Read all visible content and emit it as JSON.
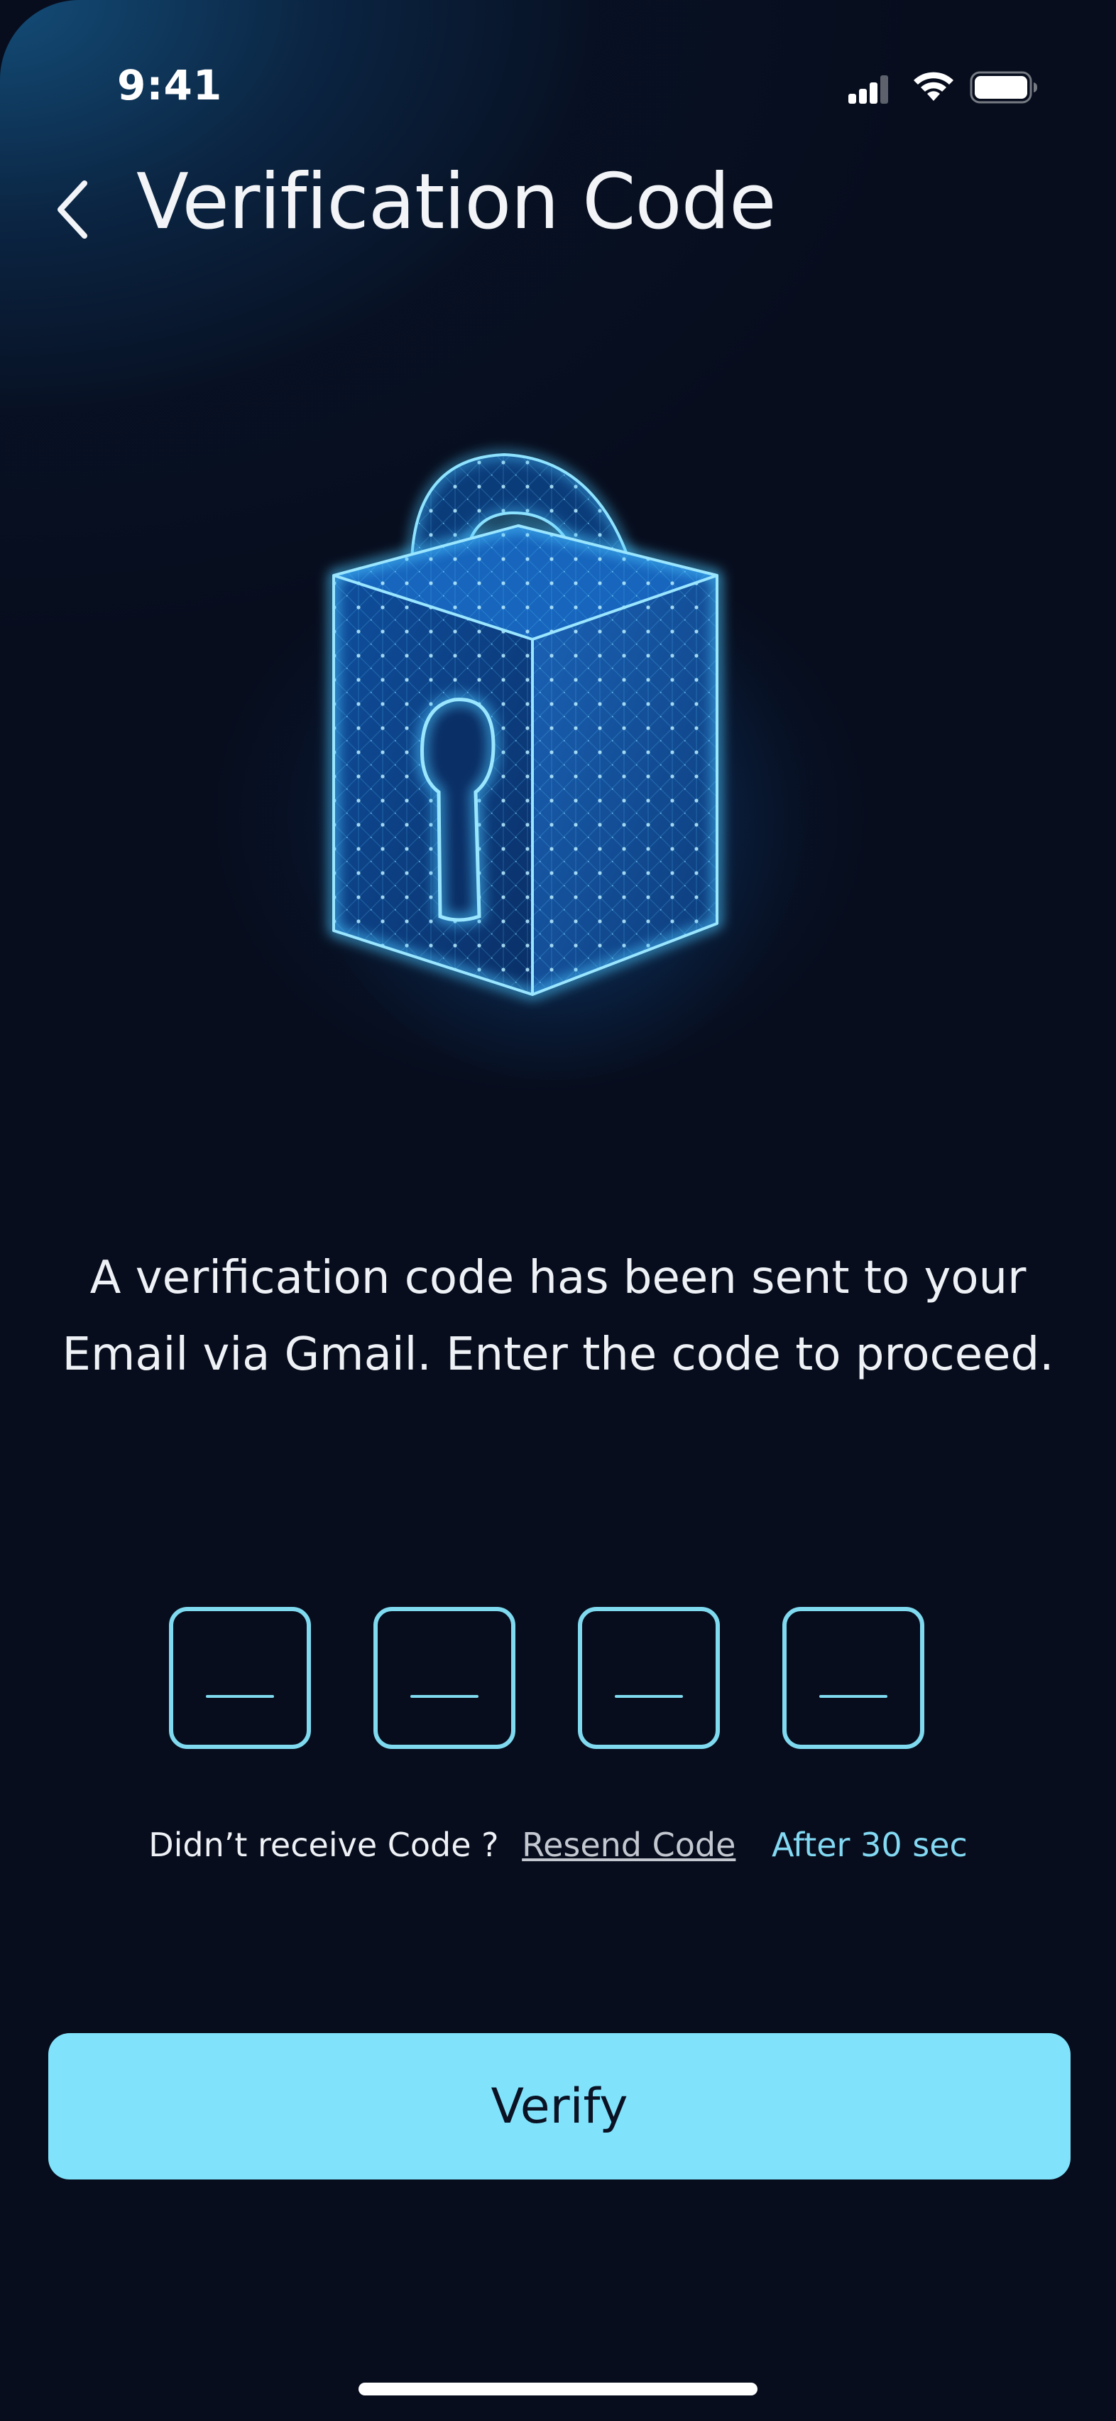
{
  "status_bar": {
    "time": "9:41"
  },
  "header": {
    "title": "Verification Code",
    "back_icon": "chevron-left-icon"
  },
  "illustration": {
    "icon": "padlock-icon"
  },
  "message": {
    "text": "A verification code has been sent to your Email via Gmail. Enter the code to proceed."
  },
  "otp": {
    "digits": [
      "",
      "",
      "",
      ""
    ]
  },
  "resend": {
    "prompt": "Didn’t receive Code ?",
    "link_label": "Resend Code",
    "timer": "After 30 sec"
  },
  "actions": {
    "verify_label": "Verify"
  },
  "colors": {
    "background": "#070d1d",
    "accent": "#80e3fb",
    "otp_border": "#7fd9ef",
    "lock_glow": "#2fb6ff"
  }
}
